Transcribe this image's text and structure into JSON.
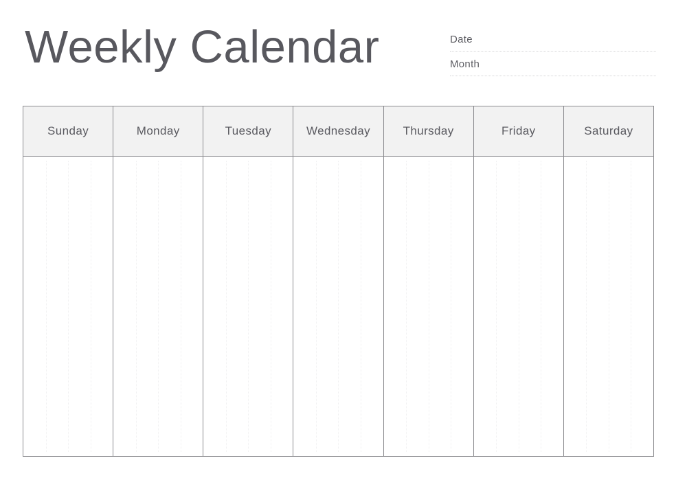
{
  "page": {
    "title": "Weekly Calendar",
    "background_color": "#ffffff",
    "title_color": "#58585e"
  },
  "meta": {
    "fields": [
      {
        "label": "Date"
      },
      {
        "label": "Month"
      }
    ],
    "line_color": "#d2d2d5"
  },
  "calendar": {
    "header_fill": "#f2f2f2",
    "border_color": "#8a8a8e",
    "guide_color": "#f0f0f1",
    "guides_per_column": 3,
    "days": [
      {
        "label": "Sunday"
      },
      {
        "label": "Monday"
      },
      {
        "label": "Tuesday"
      },
      {
        "label": "Wednesday"
      },
      {
        "label": "Thursday"
      },
      {
        "label": "Friday"
      },
      {
        "label": "Saturday"
      }
    ]
  }
}
